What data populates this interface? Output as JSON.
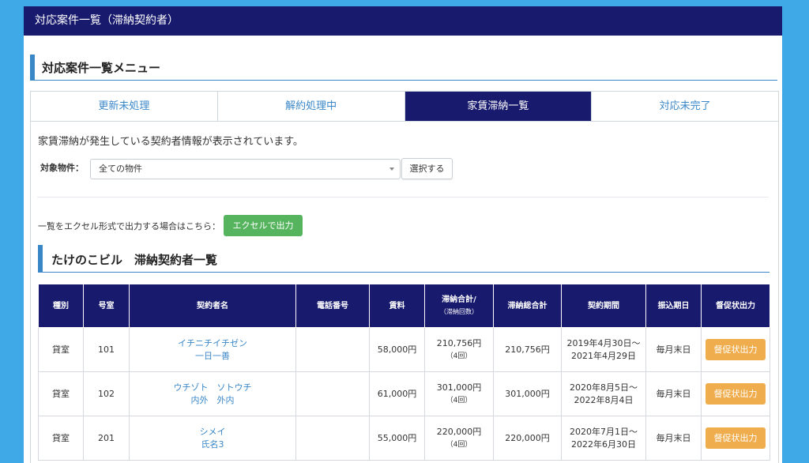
{
  "window_title": "対応案件一覧（滞納契約者）",
  "menu_heading": "対応案件一覧メニュー",
  "tabs": [
    {
      "label": "更新未処理",
      "active": false
    },
    {
      "label": "解約処理中",
      "active": false
    },
    {
      "label": "家賃滞納一覧",
      "active": true
    },
    {
      "label": "対応未完了",
      "active": false
    }
  ],
  "description": "家賃滞納が発生している契約者情報が表示されています。",
  "filter": {
    "label": "対象物件：",
    "selected": "全ての物件",
    "button_label": "選択する"
  },
  "export": {
    "text": "一覧をエクセル形式で出力する場合はこちら：",
    "button_label": "エクセルで出力"
  },
  "list_heading": "たけのこビル　滞納契約者一覧",
  "table": {
    "headers": {
      "type": "種別",
      "room": "号室",
      "name": "契約者名",
      "phone": "電話番号",
      "rent": "賃料",
      "total_main": "滞納合計/",
      "total_sub": "（滞納回数）",
      "grand_total": "滞納総合計",
      "period": "契約期間",
      "due": "振込期日",
      "dun": "督促状出力"
    },
    "rows": [
      {
        "type": "貸室",
        "room": "101",
        "kana": "イチニチイチゼン",
        "name": "一日一善",
        "phone": "",
        "rent": "58,000円",
        "total": "210,756円",
        "count": "（4回）",
        "grand_total": "210,756円",
        "period_start": "2019年4月30日～",
        "period_end": "2021年4月29日",
        "due": "毎月末日",
        "dun_label": "督促状出力"
      },
      {
        "type": "貸室",
        "room": "102",
        "kana": "ウチゾト　ソトウチ",
        "name": "内外　外内",
        "phone": "",
        "rent": "61,000円",
        "total": "301,000円",
        "count": "（4回）",
        "grand_total": "301,000円",
        "period_start": "2020年8月5日～",
        "period_end": "2022年8月4日",
        "due": "毎月末日",
        "dun_label": "督促状出力"
      },
      {
        "type": "貸室",
        "room": "201",
        "kana": "シメイ",
        "name": "氏名3",
        "phone": "",
        "rent": "55,000円",
        "total": "220,000円",
        "count": "（4回）",
        "grand_total": "220,000円",
        "period_start": "2020年7月1日～",
        "period_end": "2022年6月30日",
        "due": "毎月末日",
        "dun_label": "督促状出力"
      }
    ]
  },
  "colors": {
    "navy": "#181a6e",
    "accent_blue": "#3a87c8",
    "excel_green": "#56b45e",
    "dun_orange": "#f0ad4e",
    "background": "#3fa9e8"
  }
}
